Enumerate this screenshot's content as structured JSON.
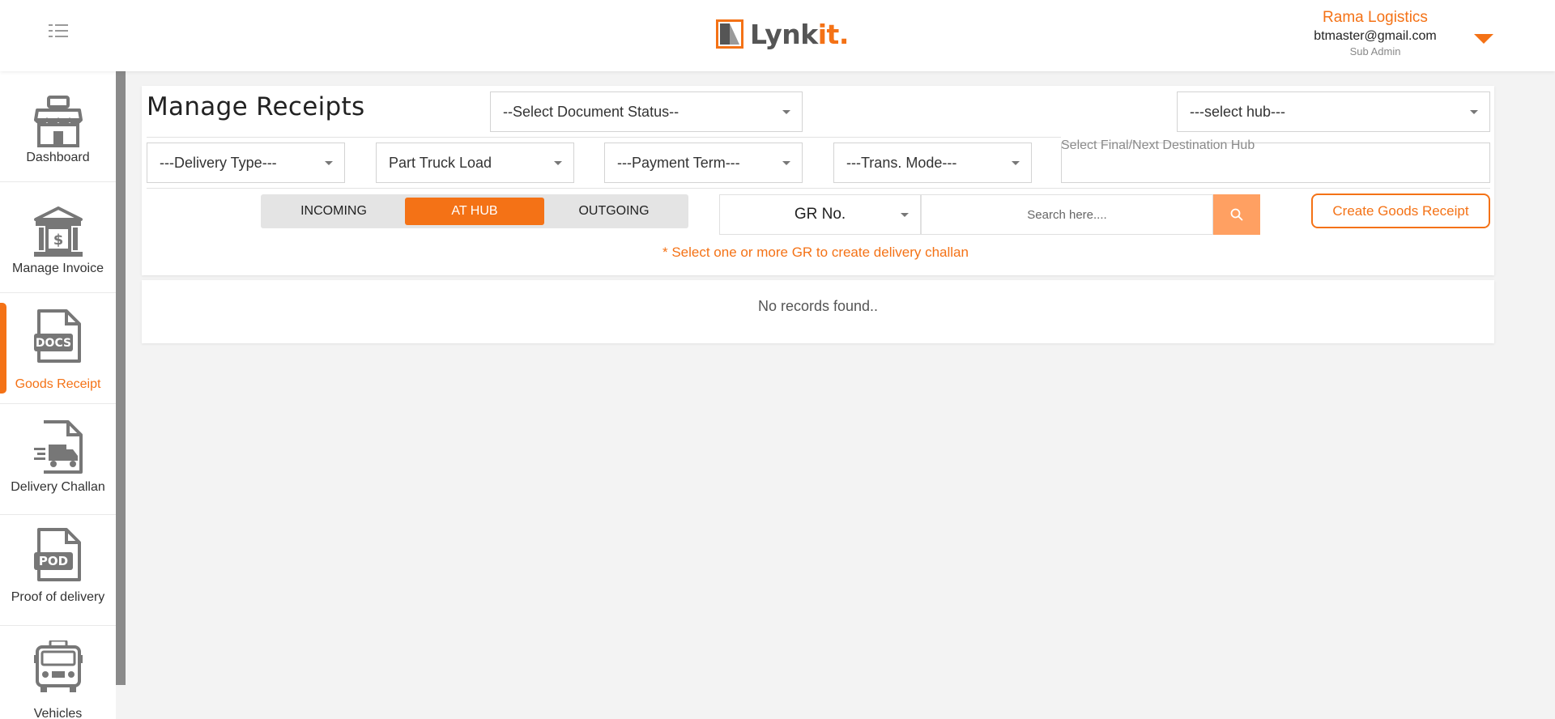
{
  "header": {
    "logo_text_main": "Lynk",
    "logo_text_accent": "it.",
    "user_company": "Rama Logistics",
    "user_email": "btmaster@gmail.com",
    "user_role": "Sub Admin"
  },
  "sidebar": {
    "items": [
      {
        "label": "Dashboard",
        "icon": "store-icon"
      },
      {
        "label": "Manage Invoice",
        "icon": "bank-icon"
      },
      {
        "label": "Goods Receipt",
        "icon": "docs-file-icon",
        "active": true,
        "badge": "DOCS"
      },
      {
        "label": "Delivery Challan",
        "icon": "truck-file-icon"
      },
      {
        "label": "Proof of delivery",
        "icon": "pod-file-icon",
        "badge": "POD"
      },
      {
        "label": "Vehicles",
        "icon": "bus-icon"
      }
    ]
  },
  "main": {
    "title": "Manage Receipts",
    "document_status_select": "--Select Document Status--",
    "hub_select": "---select hub---",
    "delivery_type_select": "---Delivery Type---",
    "load_type_select": "Part Truck Load",
    "payment_term_select": "---Payment Term---",
    "trans_mode_select": "---Trans. Mode---",
    "destination_hub_label": "Select Final/Next Destination Hub",
    "tabs": [
      {
        "label": "INCOMING"
      },
      {
        "label": "AT HUB",
        "active": true
      },
      {
        "label": "OUTGOING"
      }
    ],
    "search_type": "GR No.",
    "search_placeholder": "Search here....",
    "create_button": "Create Goods Receipt",
    "hint": "* Select one or more GR to create delivery challan",
    "no_records": "No records found.."
  },
  "colors": {
    "accent": "#f47216",
    "search_button": "#ffa062",
    "background": "#f3f3f3"
  }
}
